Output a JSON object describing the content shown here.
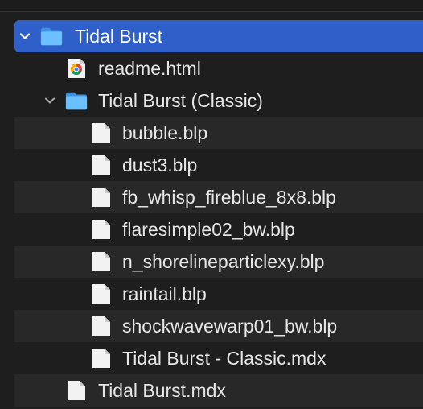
{
  "colors": {
    "background": "#1e1e1e",
    "alt_row": "#282828",
    "selection": "#2f5fc9",
    "folder_blue": "#4aa8f0",
    "text": "#e6e6e6"
  },
  "tree": {
    "root": {
      "label": "Tidal Burst",
      "icon": "folder-icon",
      "expanded": true
    },
    "readme": {
      "label": "readme.html",
      "icon": "chrome-icon"
    },
    "classic_folder": {
      "label": "Tidal Burst (Classic)",
      "icon": "folder-icon",
      "expanded": true
    },
    "classic_files": [
      {
        "label": "bubble.blp",
        "icon": "document-icon"
      },
      {
        "label": "dust3.blp",
        "icon": "document-icon"
      },
      {
        "label": "fb_whisp_fireblue_8x8.blp",
        "icon": "document-icon"
      },
      {
        "label": "flaresimple02_bw.blp",
        "icon": "document-icon"
      },
      {
        "label": "n_shorelineparticlexy.blp",
        "icon": "document-icon"
      },
      {
        "label": "raintail.blp",
        "icon": "document-icon"
      },
      {
        "label": "shockwavewarp01_bw.blp",
        "icon": "document-icon"
      },
      {
        "label": "Tidal Burst - Classic.mdx",
        "icon": "document-icon"
      }
    ],
    "root_mdx": {
      "label": "Tidal Burst.mdx",
      "icon": "document-icon"
    }
  }
}
